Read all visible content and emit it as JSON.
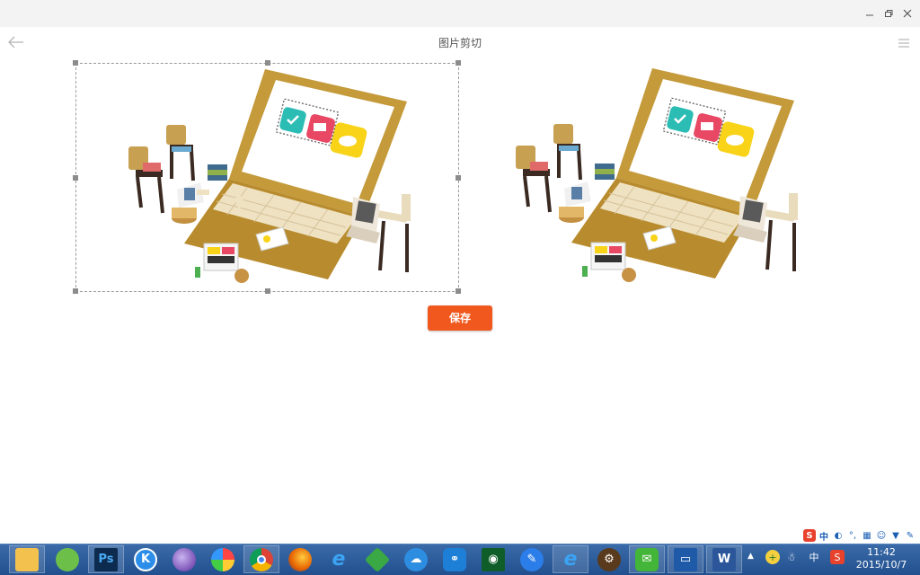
{
  "window": {
    "title": "图片剪切",
    "controls": [
      "minimize-icon",
      "restore-icon",
      "close-icon"
    ]
  },
  "header": {
    "back_icon": "arrow-left-icon",
    "menu_icon": "hamburger-menu-icon"
  },
  "main": {
    "crop_image_alt": "cardboard laptop and school desks illustration",
    "preview_image_alt": "cardboard laptop and school desks illustration",
    "save_label": "保存",
    "accent_color": "#f0581e"
  },
  "taskbar": {
    "apps": [
      {
        "name": "file-explorer",
        "icon": "folder-icon"
      },
      {
        "name": "app-green",
        "icon": "green-ball-icon"
      },
      {
        "name": "photoshop",
        "icon": "photoshop-icon",
        "text": "Ps"
      },
      {
        "name": "kugou",
        "icon": "k-icon",
        "text": "K"
      },
      {
        "name": "purple-sphere",
        "icon": "sphere-icon"
      },
      {
        "name": "colorful-app",
        "icon": "colorful-icon"
      },
      {
        "name": "chrome",
        "icon": "chrome-icon"
      },
      {
        "name": "firefox",
        "icon": "firefox-icon"
      },
      {
        "name": "ie",
        "icon": "ie-icon"
      },
      {
        "name": "green-diamond",
        "icon": "diamond-icon"
      },
      {
        "name": "cloud-app",
        "icon": "cloud-icon"
      },
      {
        "name": "network-app",
        "icon": "network-icon"
      },
      {
        "name": "eye-app",
        "icon": "eye-icon"
      },
      {
        "name": "pen-app",
        "icon": "pen-icon"
      },
      {
        "name": "ie-2",
        "icon": "ie-icon"
      },
      {
        "name": "cyber-app",
        "icon": "cyber-icon"
      },
      {
        "name": "wechat",
        "icon": "wechat-icon"
      },
      {
        "name": "remote-app",
        "icon": "monitor-icon"
      },
      {
        "name": "word",
        "icon": "word-icon",
        "text": "W"
      }
    ],
    "tray": {
      "ime_label": "中",
      "ime_label_2": "中",
      "sogou": "S"
    },
    "clock": {
      "time": "11:42",
      "date": "2015/10/7"
    }
  }
}
